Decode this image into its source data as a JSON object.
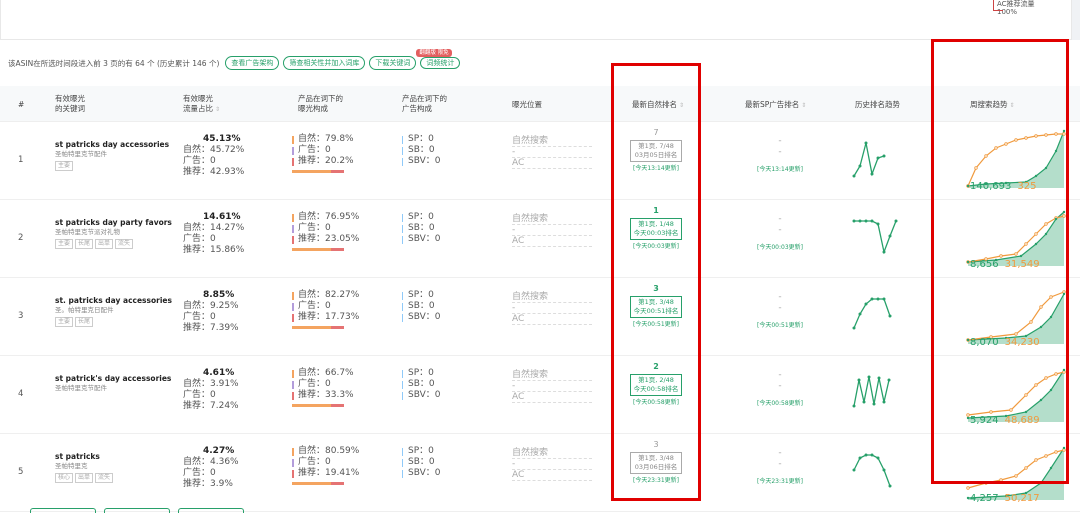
{
  "legend": {
    "label": "AC推荐流量",
    "pct": "100%"
  },
  "toolbar": {
    "summary": "该ASIN在所选时间段进入前 3 页的有 64 个 (历史累计 146 个)",
    "buttons": [
      "查看广告架构",
      "筛查相关性并加入词库",
      "下载关键词",
      "词频统计"
    ],
    "badge": "翻翻版 限免"
  },
  "columns": {
    "idx": "#",
    "kw1": "有效曝光",
    "kw2": "的关键词",
    "flow1": "有效曝光",
    "flow2": "流量占比",
    "comp1": "产品在词下的",
    "comp2": "曝光构成",
    "ad1": "产品在词下的",
    "ad2": "广告构成",
    "pos": "曝光位置",
    "rank": "最新自然排名",
    "sp": "最新SP广告排名",
    "hist": "历史排名趋势",
    "trend": "周搜索趋势"
  },
  "rows": [
    {
      "idx": "1",
      "kw_en": "st patricks day accessories",
      "kw_cn": "圣帕特里克节配件",
      "tags": [
        "主要"
      ],
      "flow_total": "45.13%",
      "flow_natural": "自然：45.72%",
      "flow_ad": "广告：0",
      "flow_rec": "推荐：42.93%",
      "comp_natural": "自然：79.8%",
      "comp_ad": "广告：0",
      "comp_rec": "推荐：20.2%",
      "ad_sp": "SP：0",
      "ad_sb": "SB：0",
      "ad_sbv": "SBV：0",
      "pos_1": "自然搜索",
      "pos_2": "-",
      "pos_3": "AC",
      "rank_num": "7",
      "rank_box1": "第1页, 7/48",
      "rank_box2": "03月05日排名",
      "rank_upd": "[今天13:14更新]",
      "rank_green": false,
      "sp_val": "-",
      "sp_upd": "[今天13:14更新]",
      "trend_green": "140,693",
      "trend_orange": "325",
      "hist_pts": [
        [
          2,
          38
        ],
        [
          8,
          28
        ],
        [
          14,
          5
        ],
        [
          20,
          36
        ],
        [
          26,
          20
        ],
        [
          32,
          18
        ]
      ],
      "trend_orange_pts": [
        [
          2,
          60
        ],
        [
          10,
          42
        ],
        [
          20,
          30
        ],
        [
          30,
          22
        ],
        [
          40,
          18
        ],
        [
          50,
          14
        ],
        [
          60,
          12
        ],
        [
          70,
          10
        ],
        [
          80,
          9
        ],
        [
          90,
          8
        ],
        [
          98,
          8
        ]
      ],
      "trend_green_pts": [
        [
          2,
          60
        ],
        [
          20,
          58
        ],
        [
          40,
          57
        ],
        [
          60,
          56
        ],
        [
          70,
          50
        ],
        [
          80,
          42
        ],
        [
          90,
          25
        ],
        [
          98,
          5
        ]
      ]
    },
    {
      "idx": "2",
      "kw_en": "st patricks day party favors",
      "kw_cn": "圣帕特里克节派对礼物",
      "tags": [
        "主要",
        "长尾",
        "出单",
        "流失"
      ],
      "flow_total": "14.61%",
      "flow_natural": "自然：14.27%",
      "flow_ad": "广告：0",
      "flow_rec": "推荐：15.86%",
      "comp_natural": "自然：76.95%",
      "comp_ad": "广告：0",
      "comp_rec": "推荐：23.05%",
      "ad_sp": "SP：0",
      "ad_sb": "SB：0",
      "ad_sbv": "SBV：0",
      "pos_1": "自然搜索",
      "pos_2": "-",
      "pos_3": "AC",
      "rank_num": "1",
      "rank_box1": "第1页, 1/48",
      "rank_box2": "今天00:03排名",
      "rank_upd": "[今天00:03更新]",
      "rank_green": true,
      "sp_val": "-",
      "sp_upd": "[今天00:03更新]",
      "trend_green": "8,656",
      "trend_orange": "31,549",
      "hist_pts": [
        [
          2,
          5
        ],
        [
          8,
          5
        ],
        [
          14,
          5
        ],
        [
          20,
          5
        ],
        [
          26,
          8
        ],
        [
          32,
          36
        ],
        [
          38,
          20
        ],
        [
          44,
          5
        ]
      ],
      "trend_orange_pts": [
        [
          2,
          58
        ],
        [
          20,
          55
        ],
        [
          35,
          52
        ],
        [
          50,
          50
        ],
        [
          60,
          40
        ],
        [
          70,
          30
        ],
        [
          80,
          20
        ],
        [
          90,
          14
        ],
        [
          98,
          12
        ]
      ],
      "trend_green_pts": [
        [
          2,
          58
        ],
        [
          30,
          56
        ],
        [
          55,
          52
        ],
        [
          70,
          40
        ],
        [
          80,
          30
        ],
        [
          90,
          15
        ],
        [
          98,
          8
        ]
      ]
    },
    {
      "idx": "3",
      "kw_en": "st. patricks day accessories",
      "kw_cn": "圣。帕特里克日配件",
      "tags": [
        "主要",
        "长尾"
      ],
      "flow_total": "8.85%",
      "flow_natural": "自然：9.25%",
      "flow_ad": "广告：0",
      "flow_rec": "推荐：7.39%",
      "comp_natural": "自然：82.27%",
      "comp_ad": "广告：0",
      "comp_rec": "推荐：17.73%",
      "ad_sp": "SP：0",
      "ad_sb": "SB：0",
      "ad_sbv": "SBV：0",
      "pos_1": "自然搜索",
      "pos_2": "-",
      "pos_3": "AC",
      "rank_num": "3",
      "rank_box1": "第1页, 3/48",
      "rank_box2": "今天00:51排名",
      "rank_upd": "[今天00:51更新]",
      "rank_green": true,
      "sp_val": "-",
      "sp_upd": "[今天00:51更新]",
      "trend_green": "8,070",
      "trend_orange": "34,230",
      "hist_pts": [
        [
          2,
          34
        ],
        [
          8,
          20
        ],
        [
          14,
          10
        ],
        [
          20,
          5
        ],
        [
          26,
          5
        ],
        [
          32,
          5
        ],
        [
          38,
          22
        ]
      ],
      "trend_orange_pts": [
        [
          2,
          58
        ],
        [
          25,
          55
        ],
        [
          50,
          52
        ],
        [
          65,
          40
        ],
        [
          75,
          25
        ],
        [
          85,
          15
        ],
        [
          98,
          10
        ]
      ],
      "trend_green_pts": [
        [
          2,
          58
        ],
        [
          40,
          56
        ],
        [
          60,
          54
        ],
        [
          75,
          45
        ],
        [
          85,
          35
        ],
        [
          98,
          12
        ]
      ]
    },
    {
      "idx": "4",
      "kw_en": "st patrick's day accessories",
      "kw_cn": "圣帕特里克节配件",
      "tags": [],
      "flow_total": "4.61%",
      "flow_natural": "自然：3.91%",
      "flow_ad": "广告：0",
      "flow_rec": "推荐：7.24%",
      "comp_natural": "自然：66.7%",
      "comp_ad": "广告：0",
      "comp_rec": "推荐：33.3%",
      "ad_sp": "SP：0",
      "ad_sb": "SB：0",
      "ad_sbv": "SBV：0",
      "pos_1": "自然搜索",
      "pos_2": "-",
      "pos_3": "AC",
      "rank_num": "2",
      "rank_box1": "第1页, 2/48",
      "rank_box2": "今天00:58排名",
      "rank_upd": "[今天00:58更新]",
      "rank_green": true,
      "sp_val": "-",
      "sp_upd": "[今天00:58更新]",
      "trend_green": "5,924",
      "trend_orange": "48,689",
      "hist_pts": [
        [
          2,
          34
        ],
        [
          7,
          8
        ],
        [
          12,
          30
        ],
        [
          17,
          5
        ],
        [
          22,
          32
        ],
        [
          27,
          6
        ],
        [
          32,
          30
        ],
        [
          37,
          8
        ]
      ],
      "trend_orange_pts": [
        [
          2,
          55
        ],
        [
          25,
          52
        ],
        [
          45,
          50
        ],
        [
          60,
          35
        ],
        [
          70,
          25
        ],
        [
          80,
          18
        ],
        [
          90,
          14
        ],
        [
          98,
          12
        ]
      ],
      "trend_green_pts": [
        [
          2,
          58
        ],
        [
          40,
          56
        ],
        [
          60,
          52
        ],
        [
          75,
          40
        ],
        [
          85,
          30
        ],
        [
          98,
          10
        ]
      ]
    },
    {
      "idx": "5",
      "kw_en": "st patricks",
      "kw_cn": "圣帕特里克",
      "tags": [
        "核心",
        "出单",
        "流失"
      ],
      "flow_total": "4.27%",
      "flow_natural": "自然：4.36%",
      "flow_ad": "广告：0",
      "flow_rec": "推荐：3.9%",
      "comp_natural": "自然：80.59%",
      "comp_ad": "广告：0",
      "comp_rec": "推荐：19.41%",
      "ad_sp": "SP：0",
      "ad_sb": "SB：0",
      "ad_sbv": "SBV：0",
      "pos_1": "自然搜索",
      "pos_2": "-",
      "pos_3": "AC",
      "rank_num": "3",
      "rank_box1": "第1页, 3/48",
      "rank_box2": "03月06日排名",
      "rank_upd": "[今天23:31更新]",
      "rank_green": false,
      "sp_val": "-",
      "sp_upd": "[今天23:31更新]",
      "trend_green": "4,257",
      "trend_orange": "50,217",
      "hist_pts": [
        [
          2,
          20
        ],
        [
          8,
          8
        ],
        [
          14,
          5
        ],
        [
          20,
          5
        ],
        [
          26,
          8
        ],
        [
          32,
          20
        ],
        [
          38,
          36
        ]
      ],
      "trend_orange_pts": [
        [
          2,
          50
        ],
        [
          20,
          45
        ],
        [
          35,
          42
        ],
        [
          50,
          38
        ],
        [
          60,
          30
        ],
        [
          70,
          22
        ],
        [
          80,
          18
        ],
        [
          90,
          14
        ],
        [
          98,
          12
        ]
      ],
      "trend_green_pts": [
        [
          2,
          60
        ],
        [
          40,
          58
        ],
        [
          60,
          55
        ],
        [
          75,
          45
        ],
        [
          85,
          30
        ],
        [
          98,
          10
        ]
      ]
    }
  ]
}
